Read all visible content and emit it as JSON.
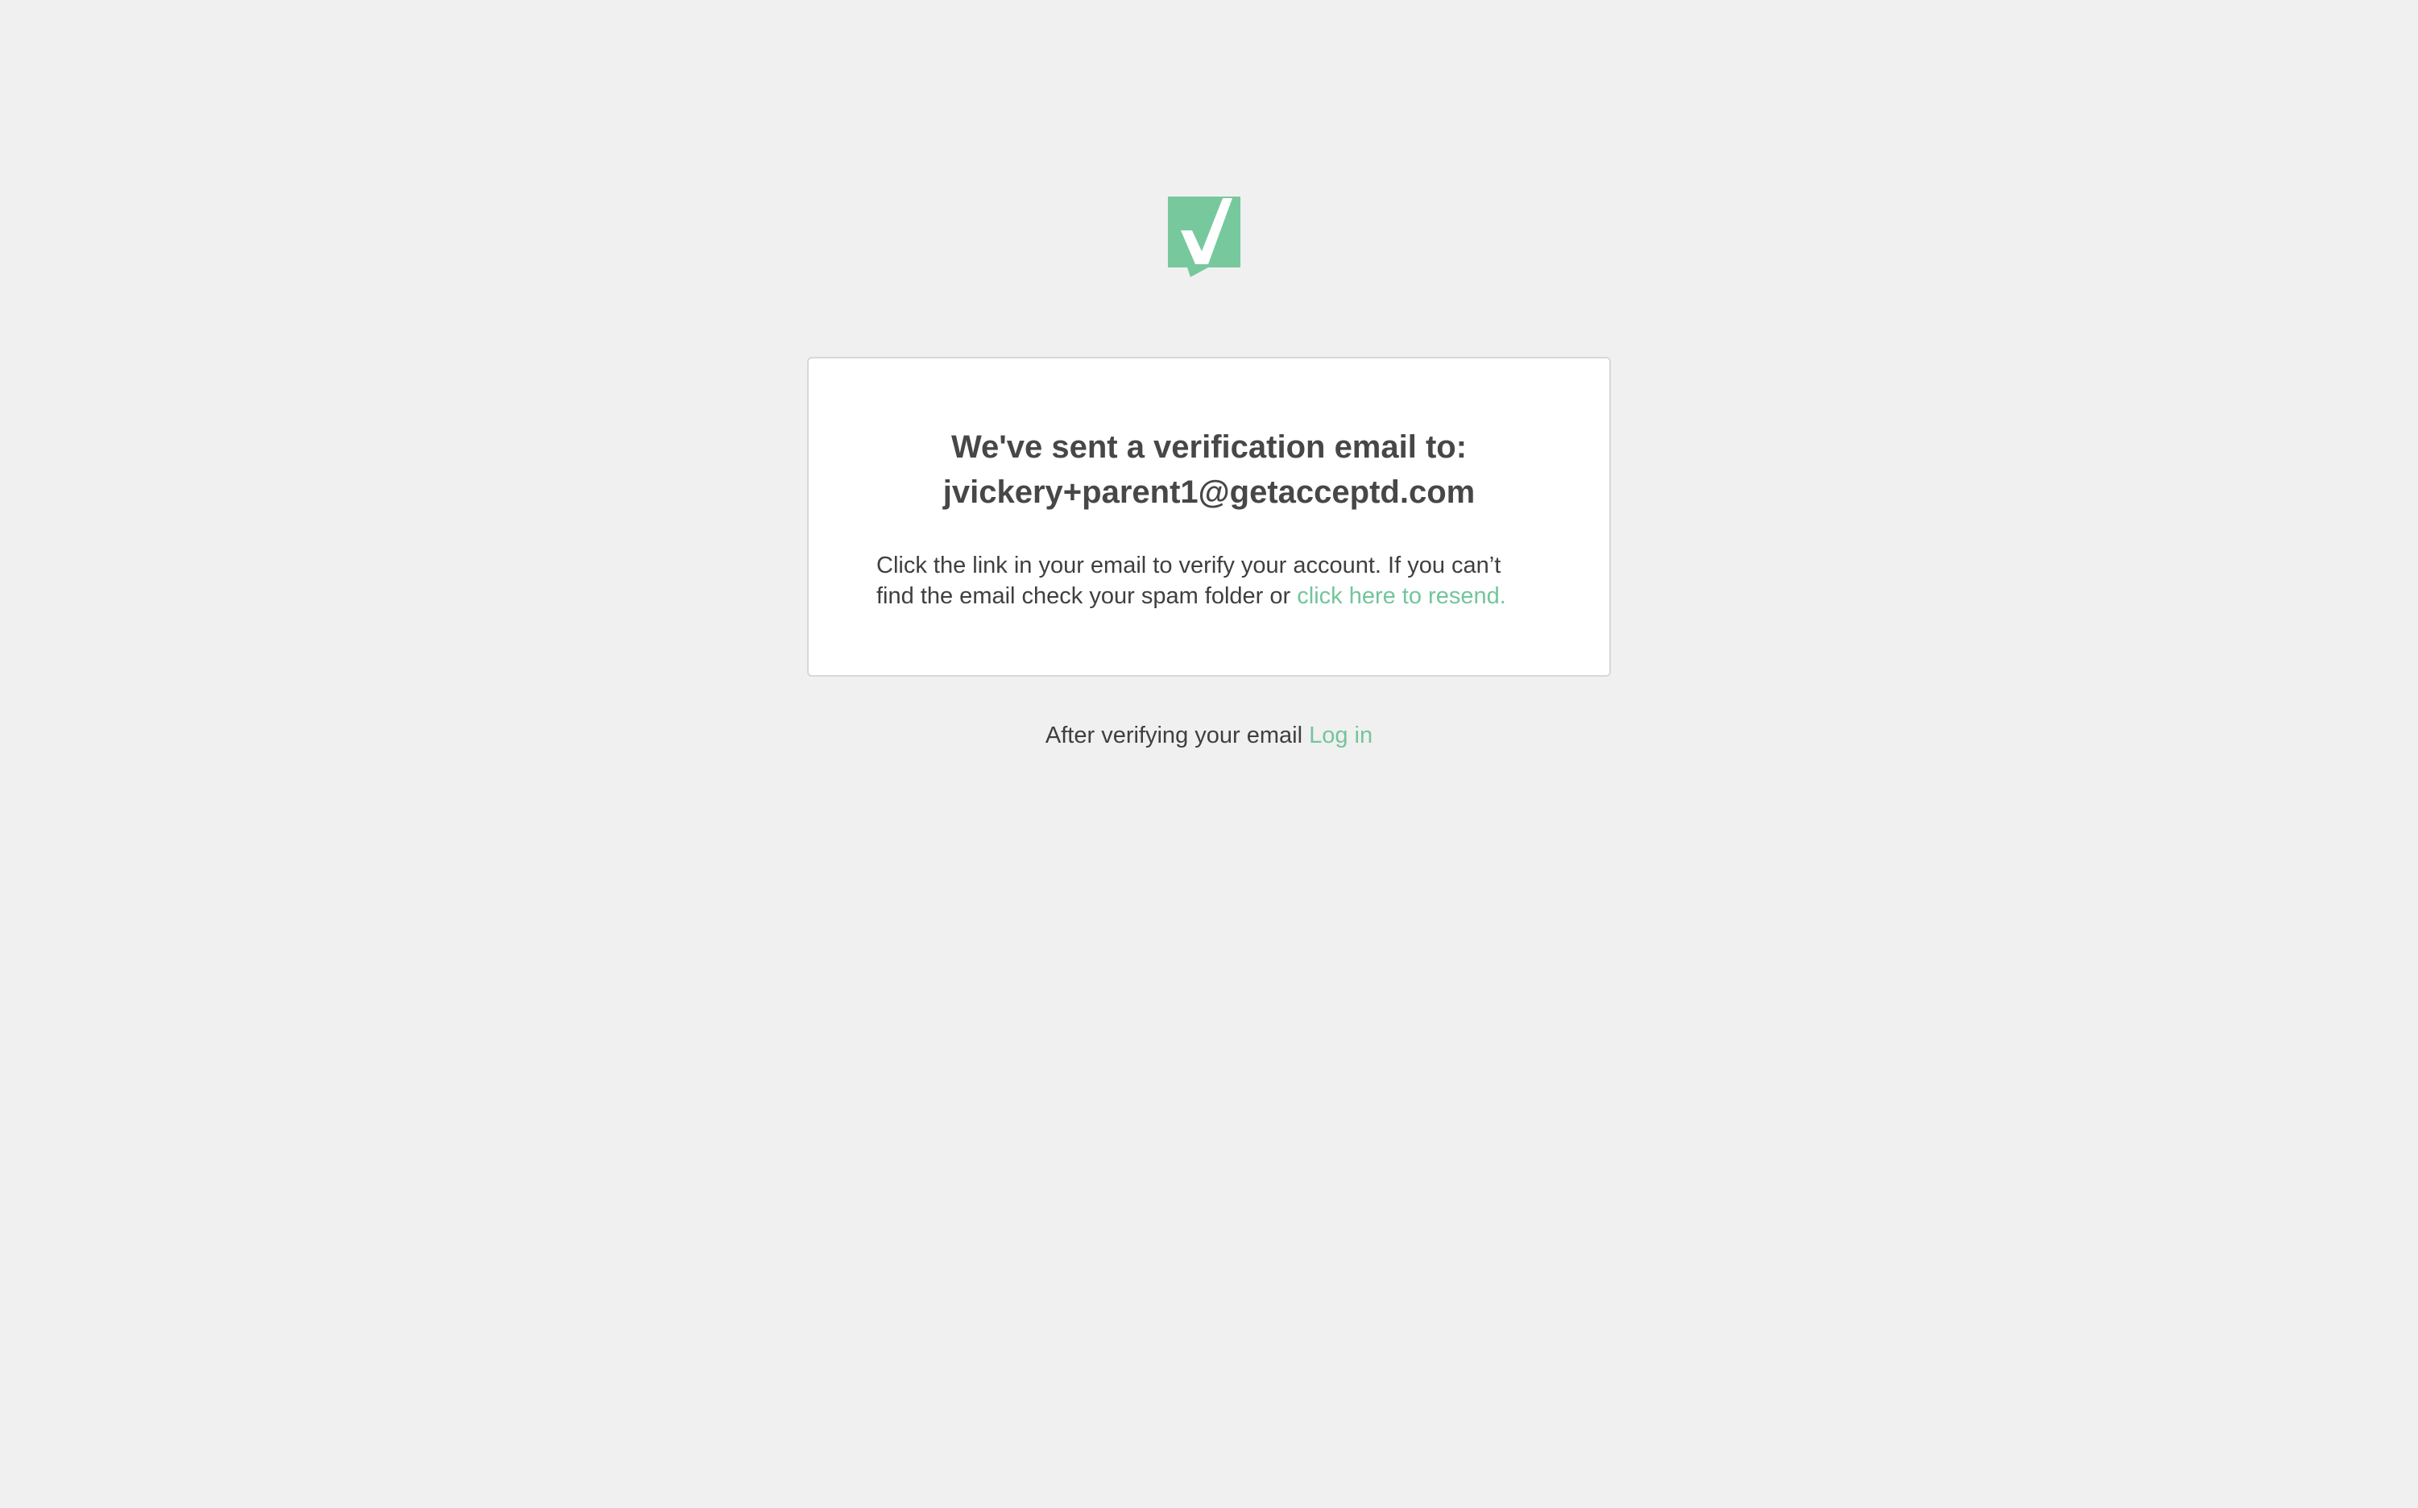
{
  "brand": {
    "logo_icon": "checkmark-flag-icon",
    "accent_color": "#78c89e"
  },
  "card": {
    "heading_line1": "We've sent a verification email to:",
    "heading_line2": "jvickery+parent1@getacceptd.com",
    "body_text": "Click the link in your email to verify your account. If you can’t find the email check your spam folder or",
    "resend_link": "click here to resend."
  },
  "footer": {
    "text": "After verifying your email",
    "login_link": "Log in"
  }
}
